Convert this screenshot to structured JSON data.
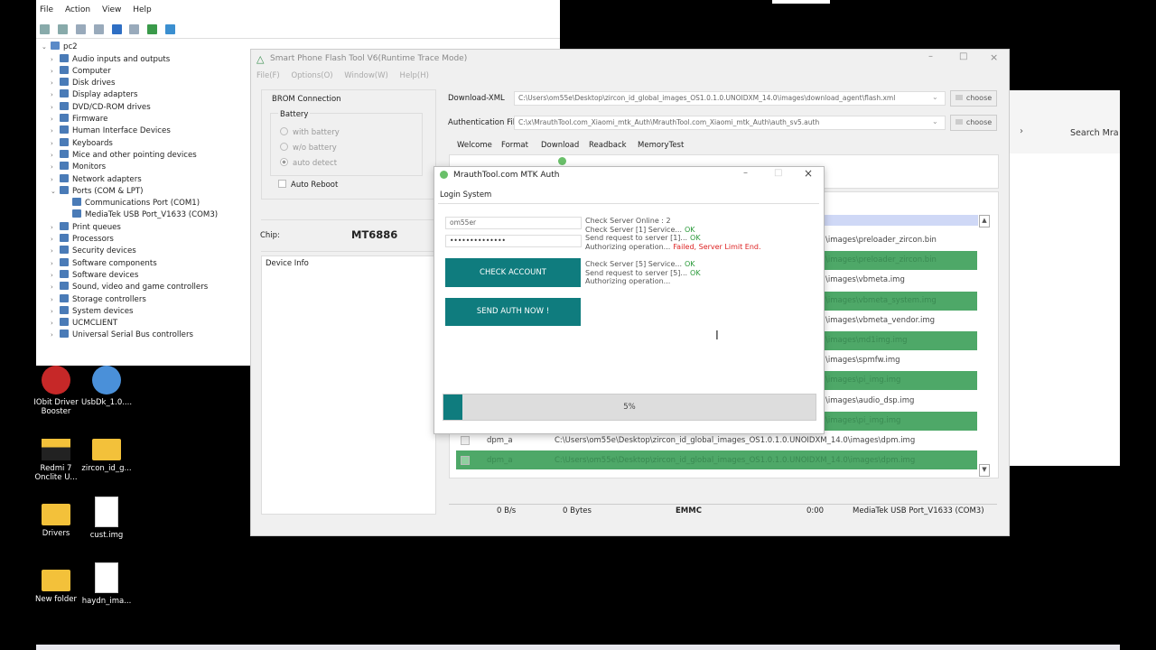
{
  "devmgr": {
    "menu": [
      "File",
      "Action",
      "View",
      "Help"
    ],
    "root": "pc2",
    "items": [
      {
        "label": "Audio inputs and outputs",
        "indent": 0,
        "arrow": "›"
      },
      {
        "label": "Computer",
        "indent": 0,
        "arrow": "›"
      },
      {
        "label": "Disk drives",
        "indent": 0,
        "arrow": "›"
      },
      {
        "label": "Display adapters",
        "indent": 0,
        "arrow": "›"
      },
      {
        "label": "DVD/CD-ROM drives",
        "indent": 0,
        "arrow": "›"
      },
      {
        "label": "Firmware",
        "indent": 0,
        "arrow": "›"
      },
      {
        "label": "Human Interface Devices",
        "indent": 0,
        "arrow": "›"
      },
      {
        "label": "Keyboards",
        "indent": 0,
        "arrow": "›"
      },
      {
        "label": "Mice and other pointing devices",
        "indent": 0,
        "arrow": "›"
      },
      {
        "label": "Monitors",
        "indent": 0,
        "arrow": "›"
      },
      {
        "label": "Network adapters",
        "indent": 0,
        "arrow": "›"
      },
      {
        "label": "Ports (COM & LPT)",
        "indent": 0,
        "arrow": "⌄"
      },
      {
        "label": "Communications Port (COM1)",
        "indent": 1,
        "arrow": ""
      },
      {
        "label": "MediaTek USB Port_V1633 (COM3)",
        "indent": 1,
        "arrow": ""
      },
      {
        "label": "Print queues",
        "indent": 0,
        "arrow": "›"
      },
      {
        "label": "Processors",
        "indent": 0,
        "arrow": "›"
      },
      {
        "label": "Security devices",
        "indent": 0,
        "arrow": "›"
      },
      {
        "label": "Software components",
        "indent": 0,
        "arrow": "›"
      },
      {
        "label": "Software devices",
        "indent": 0,
        "arrow": "›"
      },
      {
        "label": "Sound, video and game controllers",
        "indent": 0,
        "arrow": "›"
      },
      {
        "label": "Storage controllers",
        "indent": 0,
        "arrow": "›"
      },
      {
        "label": "System devices",
        "indent": 0,
        "arrow": "›"
      },
      {
        "label": "UCMCLIENT",
        "indent": 0,
        "arrow": "›"
      },
      {
        "label": "Universal Serial Bus controllers",
        "indent": 0,
        "arrow": "›"
      }
    ]
  },
  "desktop": {
    "icons": [
      {
        "label": "IObit Driver Booster",
        "kind": "app-red"
      },
      {
        "label": "UsbDk_1.0....",
        "kind": "app-blue"
      },
      {
        "label": "Redmi 7 Onclite U...",
        "kind": "folder-dark"
      },
      {
        "label": "zircon_id_g...",
        "kind": "folder"
      },
      {
        "label": "Drivers",
        "kind": "folder"
      },
      {
        "label": "cust.img",
        "kind": "file-disc"
      },
      {
        "label": "New folder",
        "kind": "folder"
      },
      {
        "label": "haydn_ima...",
        "kind": "file"
      }
    ]
  },
  "sidewindow": {
    "search": "Search Mra"
  },
  "flash": {
    "title": "Smart Phone Flash Tool V6(Runtime Trace Mode)",
    "menu": [
      "File(F)",
      "Options(O)",
      "Window(W)",
      "Help(H)"
    ],
    "brom_title": "BROM Connection",
    "battery_title": "Battery",
    "battery_options": [
      "with battery",
      "w/o battery",
      "auto detect"
    ],
    "auto_reboot": "Auto Reboot",
    "chip_label": "Chip:",
    "chip_value": "MT6886",
    "device_info": "Device Info",
    "download_xml_label": "Download-XML",
    "download_xml_value": "C:\\Users\\om55e\\Desktop\\zircon_id_global_images_OS1.0.1.0.UNOIDXM_14.0\\images\\download_agent\\flash.xml",
    "auth_label": "Authentication File",
    "auth_value": "C:\\x\\MrauthTool.com_Xiaomi_mtk_Auth\\MrauthTool.com_Xiaomi_mtk_Auth\\auth_sv5.auth",
    "choose": "choose",
    "tabs": [
      "Welcome",
      "Format",
      "Download",
      "Readback",
      "MemoryTest"
    ],
    "rows": [
      {
        "text": "\\images\\preloader_zircon.bin",
        "green": false
      },
      {
        "text": "\\images\\preloader_zircon.bin",
        "green": true
      },
      {
        "text": "\\images\\vbmeta.img",
        "green": false
      },
      {
        "text": "\\images\\vbmeta_system.img",
        "green": true
      },
      {
        "text": "\\images\\vbmeta_vendor.img",
        "green": false
      },
      {
        "text": "\\images\\md1img.img",
        "green": true
      },
      {
        "text": "\\images\\spmfw.img",
        "green": false
      },
      {
        "text": "\\images\\pi_img.img",
        "green": true
      },
      {
        "text": "\\images\\audio_dsp.img",
        "green": false
      },
      {
        "text": "\\images\\pi_img.img",
        "green": true
      }
    ],
    "bottom_rows": [
      {
        "name": "dpm_a",
        "path": "C:\\Users\\om55e\\Desktop\\zircon_id_global_images_OS1.0.1.0.UNOIDXM_14.0\\images\\dpm.img",
        "green": false
      },
      {
        "name": "dpm_a",
        "path": "C:\\Users\\om55e\\Desktop\\zircon_id_global_images_OS1.0.1.0.UNOIDXM_14.0\\images\\dpm.img",
        "green": true
      }
    ],
    "status": {
      "speed": "0 B/s",
      "bytes": "0 Bytes",
      "storage": "EMMC",
      "time": "0:00",
      "port": "MediaTek USB Port_V1633 (COM3)"
    }
  },
  "auth": {
    "title": "MrauthTool.com MTK Auth",
    "tab": "Login System",
    "username": "om55er",
    "password": "••••••••••••••",
    "check_button": "CHECK ACCOUNT",
    "send_button": "SEND AUTH NOW !",
    "progress_percent": 5,
    "progress_label": "5%",
    "log1": [
      {
        "text": "Check Server Online : 2",
        "status": "",
        "cls": ""
      },
      {
        "text": "Check Server [1] Service...",
        "status": "OK",
        "cls": "ok"
      },
      {
        "text": "Send request to server [1]...",
        "status": "OK",
        "cls": "ok"
      },
      {
        "text": "Authorizing operation...",
        "status": "Failed, Server Limit End.",
        "cls": "fail"
      }
    ],
    "log2": [
      {
        "text": "Check Server [5] Service...",
        "status": "OK",
        "cls": "ok"
      },
      {
        "text": "Send request to server [5]...",
        "status": "OK",
        "cls": "ok"
      },
      {
        "text": "Authorizing operation...",
        "status": "",
        "cls": ""
      }
    ]
  }
}
